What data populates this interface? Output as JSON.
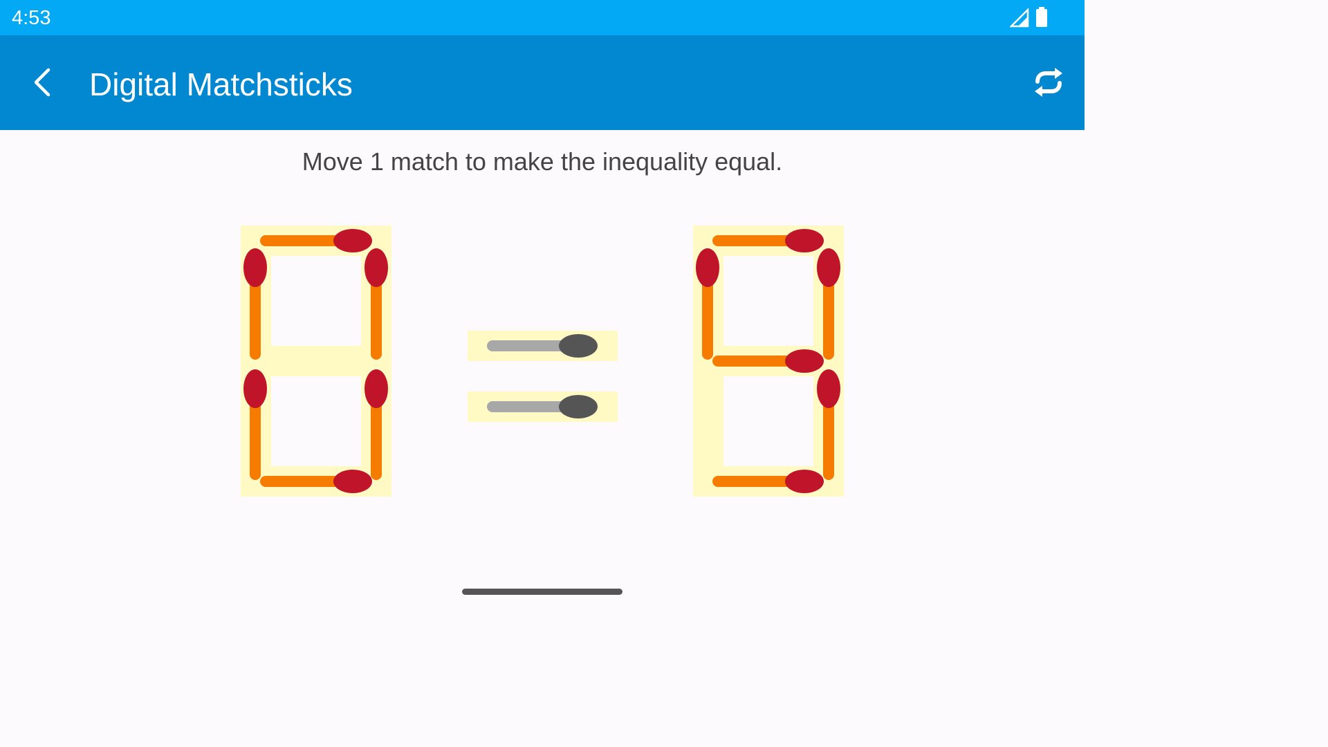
{
  "status_bar": {
    "time": "4:53",
    "icons": [
      "signal-icon",
      "battery-icon"
    ]
  },
  "app_bar": {
    "title": "Digital Matchsticks",
    "back_icon": "chevron-left-icon",
    "refresh_icon": "refresh-icon"
  },
  "puzzle": {
    "instruction": "Move 1 match to make the inequality equal.",
    "left_digit": "8",
    "operator": "=",
    "right_digit": "9",
    "colors": {
      "slot_background": "#FFF9C4",
      "stick": "#F57C00",
      "head": "#C0142A",
      "operator_stick": "#A8A8A8",
      "operator_head": "#555555"
    }
  }
}
